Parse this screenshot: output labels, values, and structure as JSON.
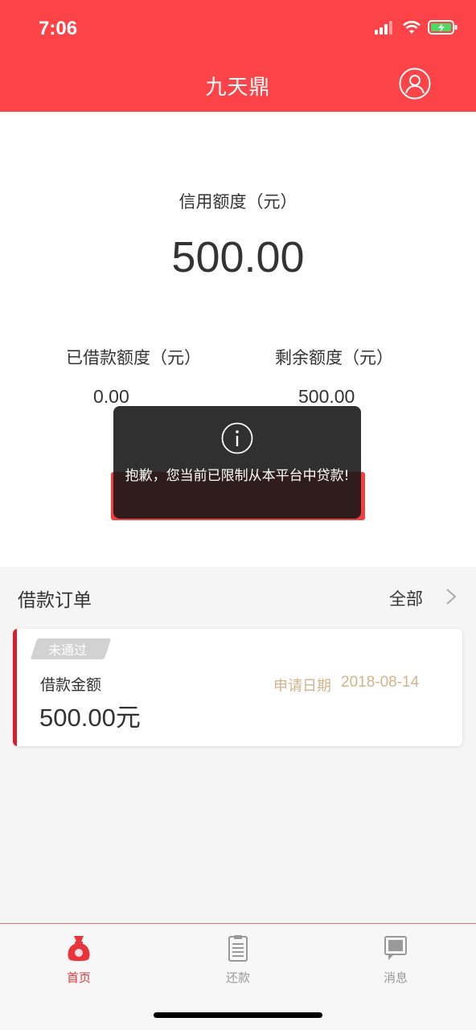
{
  "status_bar": {
    "time": "7:06"
  },
  "header": {
    "title": "九天鼎"
  },
  "credit": {
    "label": "信用额度（元）",
    "value": "500.00"
  },
  "borrowed": {
    "label": "已借款额度（元）",
    "value": "0.00"
  },
  "remaining": {
    "label": "剩余额度（元）",
    "value": "500.00"
  },
  "toast": {
    "message": "抱歉，您当前已限制从本平台中贷款!"
  },
  "orders": {
    "title": "借款订单",
    "all_label": "全部",
    "items": [
      {
        "status": "未通过",
        "amount_label": "借款金额",
        "amount": "500.00元",
        "date_label": "申请日期",
        "date": "2018-08-14"
      }
    ]
  },
  "tabbar": {
    "items": [
      {
        "label": "首页",
        "icon": "money-bag-icon",
        "active": true
      },
      {
        "label": "还款",
        "icon": "clipboard-icon",
        "active": false
      },
      {
        "label": "消息",
        "icon": "message-icon",
        "active": false
      }
    ]
  },
  "colors": {
    "brand": "#fc4348",
    "accent_red": "#d81e2a",
    "date_gold": "#d2b48c",
    "inactive": "#999999"
  }
}
